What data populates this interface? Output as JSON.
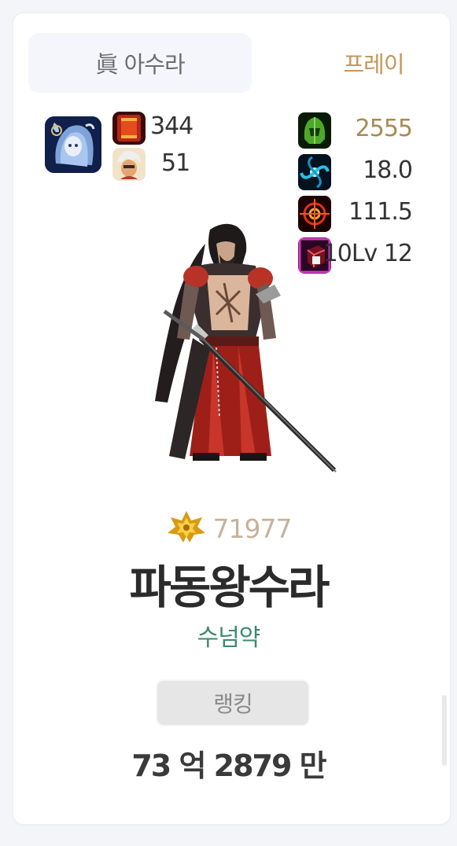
{
  "card": {
    "class_name": "眞 아수라",
    "server": "프레이"
  },
  "left_stats": {
    "avatar_icon": "blue-haired-creature-avatar-icon",
    "items": [
      {
        "icon": "red-banner-icon",
        "value": "344"
      },
      {
        "icon": "white-haired-character-icon",
        "value": "51"
      }
    ]
  },
  "right_stats": [
    {
      "icon": "green-helmet-icon",
      "value": "2555",
      "color": "#a88a55"
    },
    {
      "icon": "blue-swirl-icon",
      "value": "18.0",
      "color": "#333333"
    },
    {
      "icon": "red-crosshair-icon",
      "value": "111.5",
      "color": "#333333"
    },
    {
      "icon": "magenta-cube-icon",
      "value": "10Lv 12",
      "color": "#333333"
    }
  ],
  "character": {
    "sprite_icon": "swordsman-character-sprite"
  },
  "fame": {
    "icon": "gold-emblem-icon",
    "value": "71977"
  },
  "character_name": "파동왕수라",
  "guild_name": "수넘약",
  "ranking_button_label": "랭킹",
  "damage_value": "73 억 2879 만",
  "colors": {
    "server": "#c7955a",
    "fame": "#c6b29a",
    "guild": "#3d8a6e",
    "name": "#2b2b2b"
  }
}
